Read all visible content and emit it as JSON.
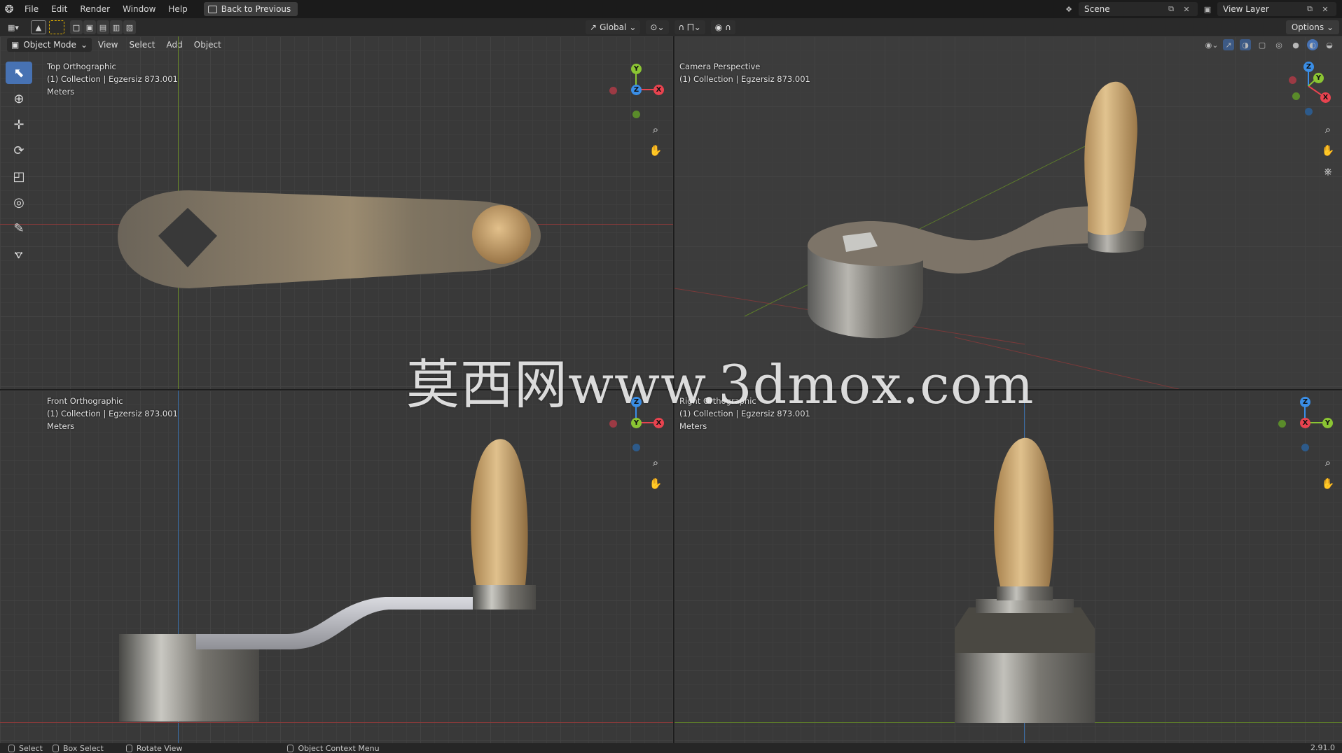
{
  "topbar": {
    "menus": [
      "File",
      "Edit",
      "Render",
      "Window",
      "Help"
    ],
    "back_button": "Back to Previous",
    "scene": "Scene",
    "view_layer": "View Layer"
  },
  "toolbar": {
    "transform_orientation": "Global",
    "options": "Options"
  },
  "viewport_header": {
    "mode": "Object Mode",
    "menus": [
      "View",
      "Select",
      "Add",
      "Object"
    ]
  },
  "viewports": {
    "top_left": {
      "title": "Top Orthographic",
      "collection": "(1) Collection | Egzersiz 873.001",
      "units": "Meters"
    },
    "top_right": {
      "title": "Camera Perspective",
      "collection": "(1) Collection | Egzersiz 873.001"
    },
    "bottom_left": {
      "title": "Front Orthographic",
      "collection": "(1) Collection | Egzersiz 873.001",
      "units": "Meters"
    },
    "bottom_right": {
      "title": "Right Orthographic",
      "collection": "(1) Collection | Egzersiz 873.001",
      "units": "Meters"
    }
  },
  "gizmo_labels": {
    "x": "X",
    "y": "Y",
    "z": "Z"
  },
  "statusbar": {
    "select": "Select",
    "box_select": "Box Select",
    "rotate_view": "Rotate View",
    "context_menu": "Object Context Menu",
    "version": "2.91.0"
  },
  "watermark": "莫西网www.3dmox.com",
  "colors": {
    "accent": "#4772b3",
    "axis_x": "#e8434f",
    "axis_y": "#8bc533",
    "axis_z": "#3a8ee6"
  }
}
